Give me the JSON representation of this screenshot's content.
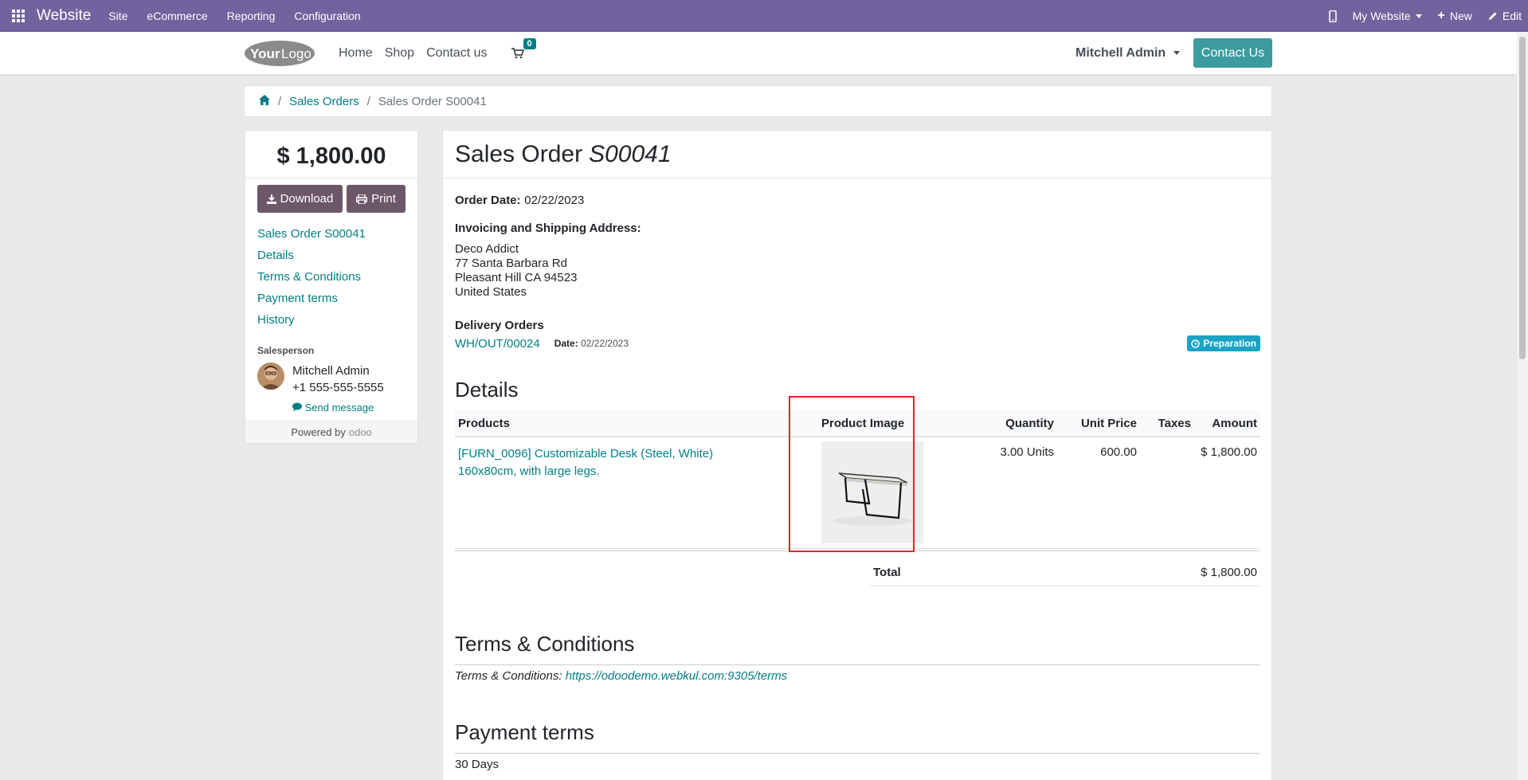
{
  "adminbar": {
    "brand": "Website",
    "menu": [
      "Site",
      "eCommerce",
      "Reporting",
      "Configuration"
    ],
    "website_select": "My Website",
    "new_label": "New",
    "edit_label": "Edit"
  },
  "header": {
    "logo_text": "YourLogo",
    "nav": [
      "Home",
      "Shop",
      "Contact us"
    ],
    "cart_count": "0",
    "user": "Mitchell Admin",
    "contact_button": "Contact Us"
  },
  "breadcrumb": {
    "items": [
      "Sales Orders",
      "Sales Order S00041"
    ],
    "separator": "/"
  },
  "sidebar": {
    "amount": "$ 1,800.00",
    "download_label": "Download",
    "print_label": "Print",
    "links": [
      "Sales Order S00041",
      "Details",
      "Terms & Conditions",
      "Payment terms",
      "History"
    ],
    "salesperson_label": "Salesperson",
    "salesperson_name": "Mitchell Admin",
    "salesperson_phone": "+1 555-555-5555",
    "send_message": "Send message",
    "powered_by": "Powered by",
    "odoo": "odoo"
  },
  "order": {
    "title_prefix": "Sales Order",
    "number": "S00041",
    "order_date_label": "Order Date:",
    "order_date": "02/22/2023",
    "address_label": "Invoicing and Shipping Address:",
    "address": [
      "Deco Addict",
      "77 Santa Barbara Rd",
      "Pleasant Hill CA 94523",
      "United States"
    ],
    "delivery_label": "Delivery Orders",
    "delivery_ref": "WH/OUT/00024",
    "delivery_date_label": "Date:",
    "delivery_date": "02/22/2023",
    "delivery_status": "Preparation",
    "details_heading": "Details",
    "columns": [
      "Products",
      "Product Image",
      "Quantity",
      "Unit Price",
      "Taxes",
      "Amount"
    ],
    "line": {
      "product": "[FURN_0096] Customizable Desk (Steel, White)",
      "product_desc": "160x80cm, with large legs.",
      "quantity": "3.00 Units",
      "unit_price": "600.00",
      "taxes": "",
      "amount": "$ 1,800.00"
    },
    "total_label": "Total",
    "total": "$ 1,800.00",
    "terms_heading": "Terms & Conditions",
    "terms_label": "Terms & Conditions:",
    "terms_url": "https://odoodemo.webkul.com:9305/terms",
    "payment_heading": "Payment terms",
    "payment_terms": "30 Days"
  },
  "colors": {
    "adminbar": "#71639e",
    "link": "#017e84",
    "contact_button": "#3c9b9e",
    "highlight": "#e8202a"
  }
}
